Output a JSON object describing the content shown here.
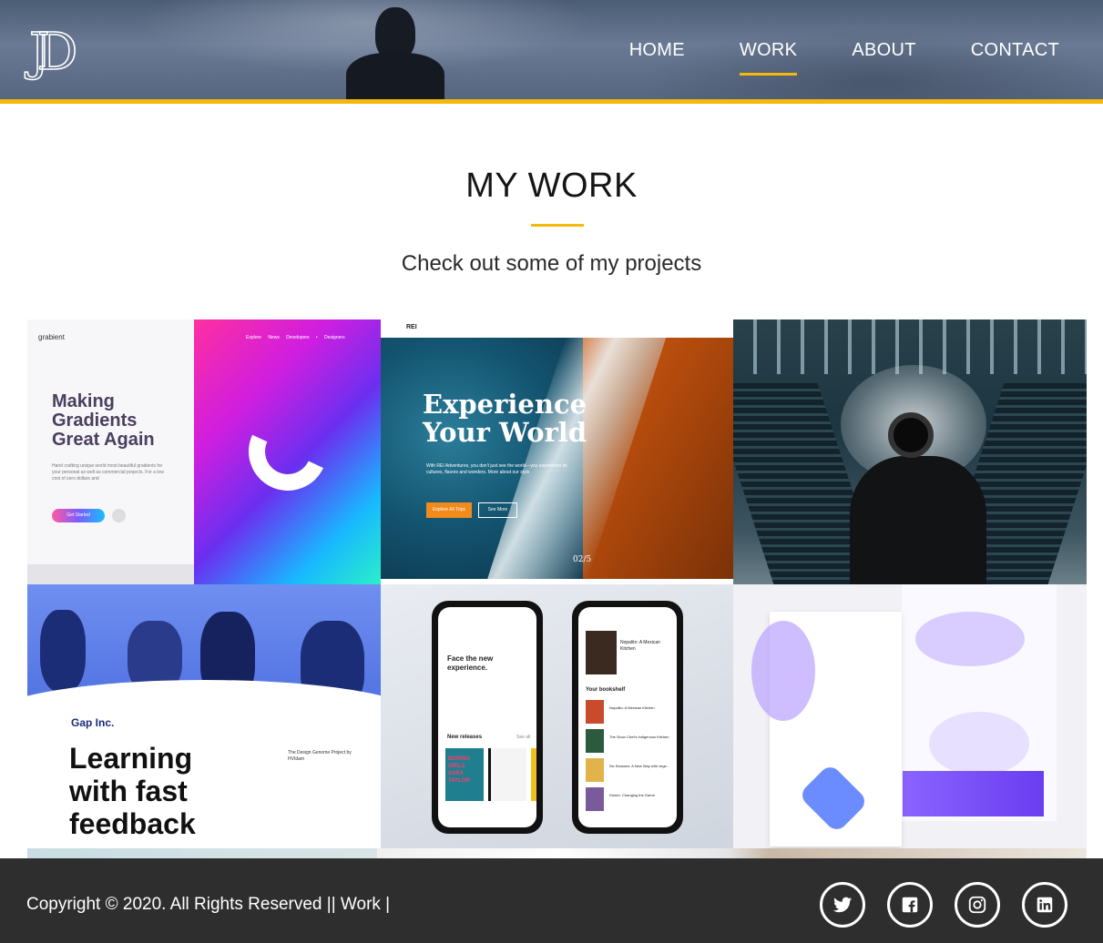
{
  "header": {
    "logo_text": "JD",
    "nav": [
      {
        "label": "HOME"
      },
      {
        "label": "WORK"
      },
      {
        "label": "ABOUT"
      },
      {
        "label": "CONTACT"
      }
    ],
    "active_nav": "WORK",
    "accent_color": "#f5b80d"
  },
  "main": {
    "title": "MY WORK",
    "subtitle": "Check out some of my projects",
    "projects": [
      {
        "name": "grabient",
        "brand": "grabient",
        "headline": "Making Gradients Great Again",
        "body": "Hand crafting unique world most beautiful gradients for your personal as well as commercial projects. For a low cost of zero dollars and",
        "button": "Get Started",
        "nav": "Explore  News  Developers  • Designers"
      },
      {
        "name": "rei-adventures",
        "brand": "REI",
        "headline": "Experience Your World",
        "body": "With REI Adventures, you don't just see the world—you experience its cultures, flavors and wonders. More about our style",
        "button_primary": "Explore All Trips",
        "button_secondary": "See More",
        "counter": "02",
        "counter_total": "5"
      },
      {
        "name": "photographer-escalator"
      },
      {
        "name": "gap-learning",
        "brand": "Gap Inc.",
        "headline": "Learning with fast feedback",
        "note": "The Design Genome Project by HVIdam"
      },
      {
        "name": "bookshelf-app",
        "left_heading": "Face the new experience.",
        "left_section": "New releases",
        "left_see_all": "See all",
        "left_book": "BORING GIRLS SARA TAYLOR",
        "right_book_title": "Nopalito: A Mexican Kitchen",
        "right_section": "Your bookshelf",
        "right_items": [
          "Nopalito: A Mexican Kitchen",
          "The Sioux Chef's Indigenous Kitchen",
          "Six Seasons: A New Way with vege...",
          "Dinner: Changing the Game"
        ]
      },
      {
        "name": "purple-landing"
      }
    ]
  },
  "footer": {
    "copyright": "Copyright © 2020. All Rights Reserved || Work |",
    "social": [
      {
        "name": "twitter",
        "icon": "twitter-icon"
      },
      {
        "name": "facebook",
        "icon": "facebook-icon"
      },
      {
        "name": "instagram",
        "icon": "instagram-icon"
      },
      {
        "name": "linkedin",
        "icon": "linkedin-icon"
      }
    ]
  }
}
